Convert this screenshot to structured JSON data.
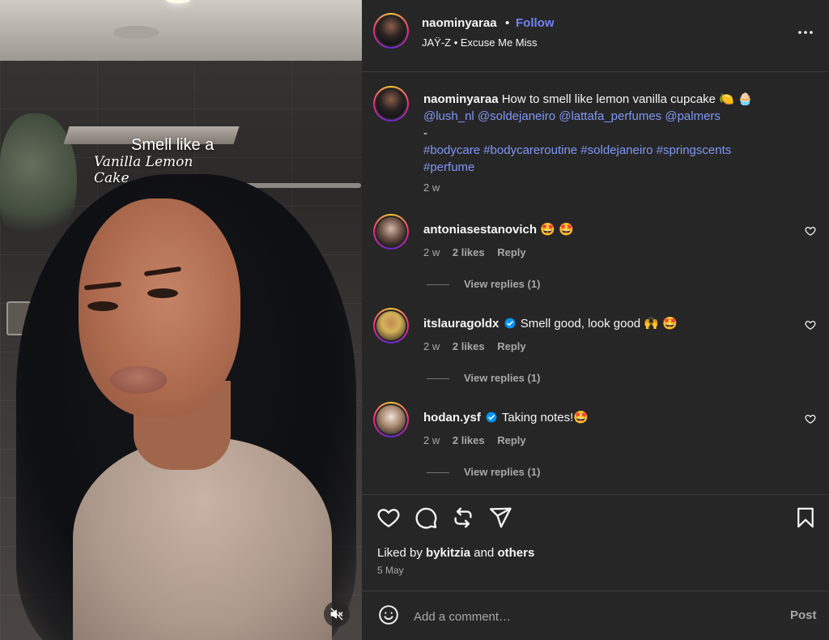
{
  "media": {
    "overlay_line1": "Smell like a",
    "overlay_line2": "Vanilla Lemon Cake",
    "mute_icon": "speaker-muted-icon"
  },
  "header": {
    "username": "naominyaraa",
    "separator": "•",
    "follow_label": "Follow",
    "audio": "JAŸ-Z • Excuse Me Miss",
    "more_icon": "more-horizontal-icon"
  },
  "caption": {
    "username": "naominyaraa",
    "text": "How to smell like lemon vanilla cupcake",
    "emojis": "🍋 🧁",
    "mentions": "@lush_nl @soldejaneiro @lattafa_perfumes @palmers",
    "dash": "-",
    "hashtags": "#bodycare #bodycareroutine #soldejaneiro #springscents #perfume",
    "time": "2 w"
  },
  "comments": [
    {
      "username": "antoniasestanovich",
      "verified": false,
      "text": "🤩 🤩",
      "time": "2 w",
      "likes": "2 likes",
      "reply": "Reply",
      "view_replies": "View replies (1)"
    },
    {
      "username": "itslauragoldx",
      "verified": true,
      "text": "Smell good, look good 🙌 🤩",
      "time": "2 w",
      "likes": "2 likes",
      "reply": "Reply",
      "view_replies": "View replies (1)"
    },
    {
      "username": "hodan.ysf",
      "verified": true,
      "text": "Taking notes!🤩",
      "time": "2 w",
      "likes": "2 likes",
      "reply": "Reply",
      "view_replies": "View replies (1)"
    }
  ],
  "actions": {
    "icons": [
      "heart-icon",
      "comment-icon",
      "repost-icon",
      "share-icon",
      "bookmark-icon"
    ]
  },
  "liked_by": {
    "prefix": "Liked by",
    "user": "bykitzia",
    "and": "and",
    "others": "others"
  },
  "date": "5 May",
  "add_comment": {
    "placeholder": "Add a comment…",
    "post_label": "Post"
  },
  "colors": {
    "background": "#262626",
    "accent_follow": "#7083f5",
    "link": "#7f97f6",
    "muted_text": "#a8a8a8",
    "verified": "#0095f6"
  }
}
